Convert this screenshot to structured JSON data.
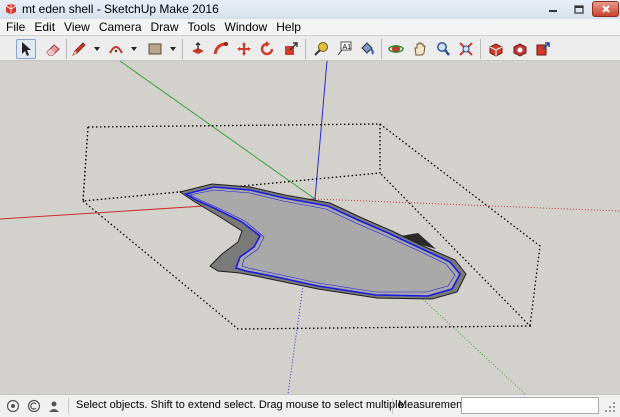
{
  "window": {
    "title": "mt eden shell - SketchUp Make 2016",
    "icon": "sketchup-logo-icon"
  },
  "menu": [
    "File",
    "Edit",
    "View",
    "Camera",
    "Draw",
    "Tools",
    "Window",
    "Help"
  ],
  "toolbar": {
    "tools": [
      "select-arrow-icon",
      "eraser-icon",
      "pencil-icon",
      "arc-icon",
      "rectangle-icon",
      "push-pull-icon",
      "follow-me-icon",
      "move-icon",
      "rotate-icon",
      "scale-icon",
      "tape-measure-icon",
      "text-icon",
      "paint-bucket-icon",
      "orbit-icon",
      "pan-icon",
      "zoom-icon",
      "zoom-extents-icon",
      "warehouse-icon",
      "extension-warehouse-icon",
      "share-model-icon"
    ],
    "active_tool": "select-arrow-icon"
  },
  "colors": {
    "viewport_bg": "#d3d1cc",
    "red_axis": "#c83030",
    "green_axis": "#3aa03a",
    "blue_axis": "#2a2ad0",
    "selection_outline": "#1a1ae0",
    "face_fill": "#a9a9a9"
  },
  "status": {
    "message": "Select objects. Shift to extend select. Drag mouse to select multiple.",
    "measurements_label": "Measurements",
    "measurements_value": ""
  }
}
